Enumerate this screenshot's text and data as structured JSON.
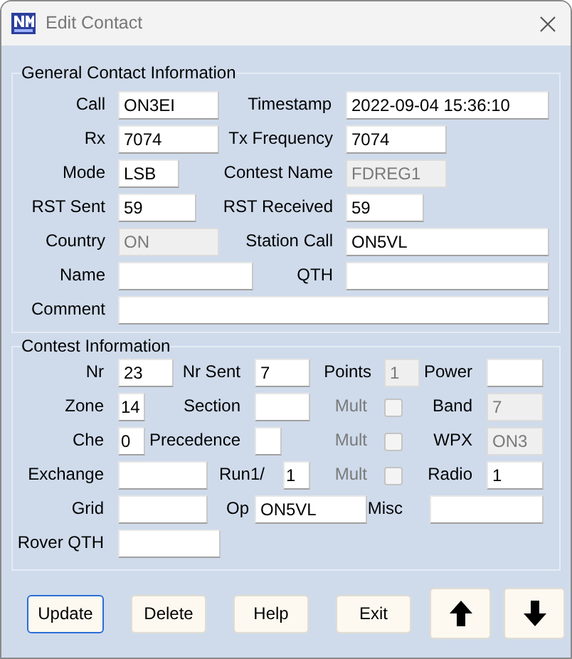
{
  "window": {
    "title": "Edit Contact"
  },
  "general": {
    "title": "General Contact Information",
    "rows": [
      [
        {
          "kind": "field",
          "label": "Call",
          "value": "ON3EI",
          "disabled": false
        },
        {
          "kind": "field",
          "label": "Timestamp",
          "value": "2022-09-04 15:36:10",
          "disabled": false
        }
      ],
      [
        {
          "kind": "field",
          "label": "Rx",
          "value": "7074",
          "disabled": false
        },
        {
          "kind": "field",
          "label": "Tx Frequency",
          "value": "7074",
          "disabled": false
        }
      ],
      [
        {
          "kind": "field",
          "label": "Mode",
          "value": "LSB",
          "disabled": false
        },
        {
          "kind": "field",
          "label": "Contest Name",
          "value": "FDREG1",
          "disabled": true
        }
      ],
      [
        {
          "kind": "field",
          "label": "RST Sent",
          "value": "59",
          "disabled": false
        },
        {
          "kind": "field",
          "label": "RST Received",
          "value": "59",
          "disabled": false
        }
      ],
      [
        {
          "kind": "field",
          "label": "Country",
          "value": "ON",
          "disabled": true
        },
        {
          "kind": "field",
          "label": "Station Call",
          "value": "ON5VL",
          "disabled": false
        }
      ],
      [
        {
          "kind": "field",
          "label": "Name",
          "disabled": false
        },
        {
          "kind": "field",
          "label": "QTH",
          "disabled": false
        }
      ],
      [
        {
          "kind": "field",
          "label": "Comment",
          "disabled": false
        }
      ]
    ]
  },
  "contest": {
    "title": "Contest Information",
    "rows": [
      [
        {
          "kind": "field",
          "label": "Nr",
          "value": "23",
          "disabled": false
        },
        {
          "kind": "field",
          "label": "Nr Sent",
          "value": "7",
          "disabled": false
        },
        {
          "kind": "field",
          "label": "Points",
          "value": "1",
          "disabled": true
        },
        {
          "kind": "field",
          "label": "Power",
          "disabled": false
        }
      ],
      [
        {
          "kind": "field",
          "label": "Zone",
          "value": "14",
          "disabled": false
        },
        {
          "kind": "field",
          "label": "Section",
          "disabled": false
        },
        {
          "kind": "checkbox",
          "label": "Mult",
          "checked": false,
          "disabled": true
        },
        {
          "kind": "field",
          "label": "Band",
          "value": "7",
          "disabled": true
        }
      ],
      [
        {
          "kind": "field",
          "label": "Che",
          "value": "0",
          "disabled": false
        },
        {
          "kind": "field",
          "label": "Precedence",
          "disabled": false
        },
        {
          "kind": "checkbox",
          "label": "Mult",
          "checked": false,
          "disabled": true
        },
        {
          "kind": "field",
          "label": "WPX",
          "value": "ON3",
          "disabled": true
        }
      ],
      [
        {
          "kind": "field",
          "label": "Exchange",
          "disabled": false
        },
        {
          "kind": "field",
          "label": "Run1/",
          "value": "1",
          "disabled": false
        },
        {
          "kind": "checkbox",
          "label": "Mult",
          "checked": false,
          "disabled": true
        },
        {
          "kind": "field",
          "label": "Radio",
          "value": "1",
          "disabled": false
        }
      ],
      [
        {
          "kind": "field",
          "label": "Grid",
          "disabled": false
        },
        {
          "kind": "field",
          "label": "Op",
          "value": "ON5VL",
          "disabled": false
        },
        {
          "kind": "field",
          "label": "Misc",
          "disabled": false
        }
      ],
      [
        {
          "kind": "field",
          "label": "Rover QTH",
          "disabled": false
        }
      ]
    ]
  },
  "buttons": [
    {
      "kind": "text",
      "label": "Update",
      "focused": true
    },
    {
      "kind": "text",
      "label": "Delete",
      "focused": false
    },
    {
      "kind": "text",
      "label": "Help",
      "focused": false
    },
    {
      "kind": "text",
      "label": "Exit",
      "focused": false
    },
    {
      "kind": "arrow-up",
      "focused": false
    },
    {
      "kind": "arrow-down",
      "focused": false
    }
  ]
}
